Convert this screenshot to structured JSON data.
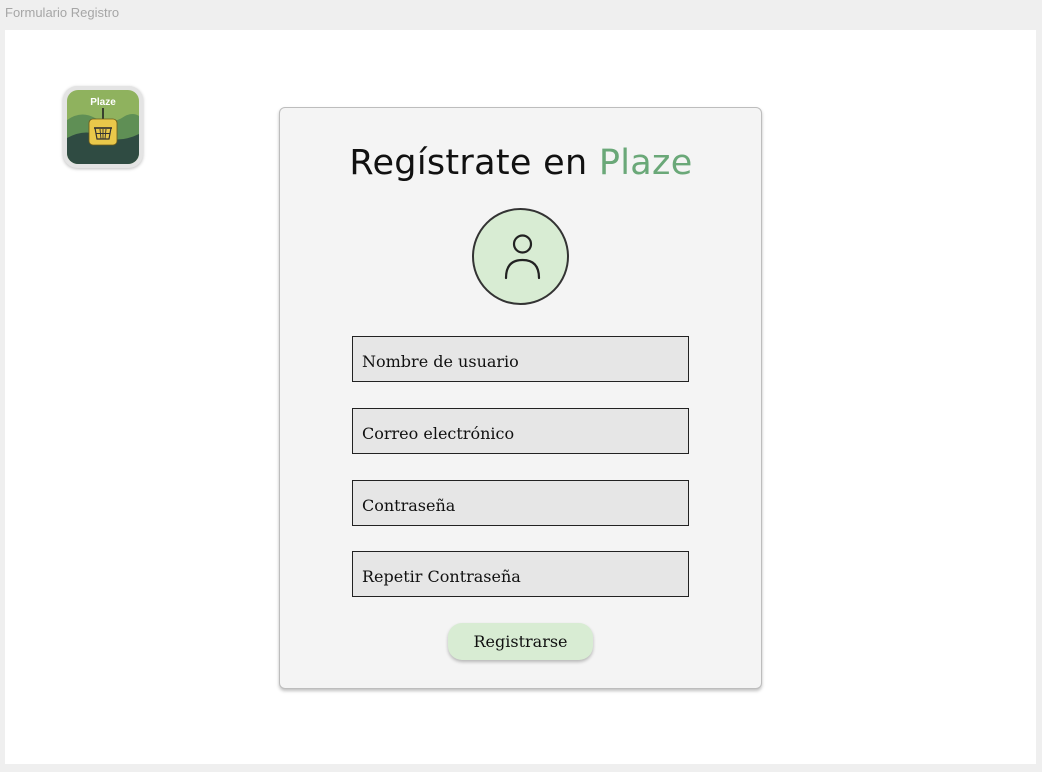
{
  "window": {
    "title": "Formulario Registro"
  },
  "logo": {
    "text": "Plaze",
    "icon": "shopping-basket-icon"
  },
  "form": {
    "heading_prefix": "Regístrate en",
    "heading_brand": "Plaze",
    "avatar_icon": "user-icon",
    "fields": {
      "username": "Nombre de usuario",
      "email": "Correo electrónico",
      "password": "Contraseña",
      "password_repeat": "Repetir Contraseña"
    },
    "submit_label": "Registrarse"
  },
  "colors": {
    "brand": "#6aa878",
    "accent_light": "#d8ecd3",
    "field_background": "#e6e6e6"
  }
}
